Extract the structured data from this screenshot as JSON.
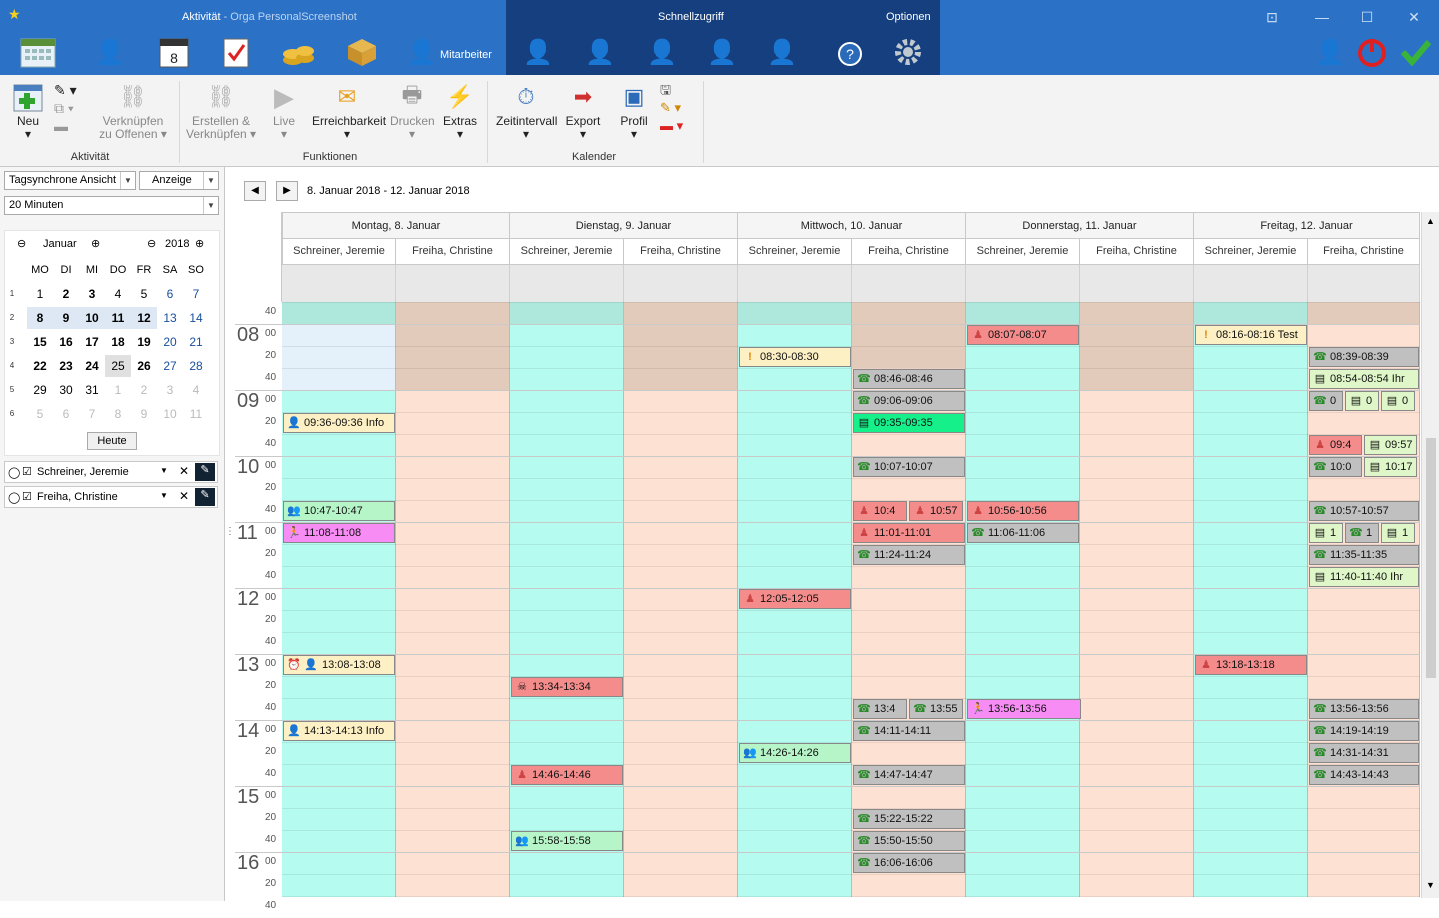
{
  "app": {
    "title_section": "Aktivität",
    "title_app": " - Orga PersonalScreenshot",
    "quick_access": "Schnellzugriff",
    "options": "Optionen",
    "mitarbeiter": "Mitarbeiter"
  },
  "ribbon": {
    "neu": "Neu",
    "verknuepfen": "Verknüpfen",
    "zu_offenen": "zu Offenen",
    "erstellen": "Erstellen &",
    "verknuepfen2": "Verknüpfen",
    "live": "Live",
    "erreichbarkeit": "Erreichbarkeit",
    "drucken": "Drucken",
    "extras": "Extras",
    "zeitintervall": "Zeitintervall",
    "export": "Export",
    "profil": "Profil",
    "grp_aktivitaet": "Aktivität",
    "grp_funktionen": "Funktionen",
    "grp_kalender": "Kalender"
  },
  "left": {
    "view_select": "Tagsynchrone Ansicht",
    "anzeige": "Anzeige",
    "interval_select": "20 Minuten",
    "month": "Januar",
    "year": "2018",
    "weekdays": [
      "MO",
      "DI",
      "MI",
      "DO",
      "FR",
      "SA",
      "SO"
    ],
    "weeks": [
      "1",
      "2",
      "3",
      "4",
      "5",
      "6"
    ],
    "days": [
      [
        "1",
        "2",
        "3",
        "4",
        "5",
        "6",
        "7"
      ],
      [
        "8",
        "9",
        "10",
        "11",
        "12",
        "13",
        "14"
      ],
      [
        "15",
        "16",
        "17",
        "18",
        "19",
        "20",
        "21"
      ],
      [
        "22",
        "23",
        "24",
        "25",
        "26",
        "27",
        "28"
      ],
      [
        "29",
        "30",
        "31",
        "1",
        "2",
        "3",
        "4"
      ],
      [
        "5",
        "6",
        "7",
        "8",
        "9",
        "10",
        "11"
      ]
    ],
    "today_button": "Heute",
    "resources": [
      "Schreiner, Jeremie",
      "Freiha, Christine"
    ]
  },
  "calendar": {
    "range": "8. Januar 2018 - 12. Januar 2018",
    "days": [
      "Montag, 8. Januar",
      "Dienstag, 9. Januar",
      "Mittwoch, 10. Januar",
      "Donnerstag, 11. Januar",
      "Freitag, 12. Januar"
    ],
    "persons": [
      "Schreiner, Jeremie",
      "Freiha, Christine"
    ],
    "hours": [
      "08",
      "09",
      "10",
      "11",
      "12",
      "13",
      "14",
      "15",
      "16"
    ],
    "minute_labels": [
      "40",
      "00",
      "20",
      "40",
      "00",
      "20",
      "40",
      "00",
      "20",
      "40",
      "00",
      "20",
      "40",
      "00",
      "20",
      "40",
      "00",
      "20",
      "40",
      "00",
      "20",
      "40",
      "00",
      "20",
      "40",
      "00",
      "20",
      "40"
    ],
    "events": [
      {
        "col": 6,
        "row": 1,
        "text": "08:07-08:07",
        "color": "red",
        "icon": "person-icon"
      },
      {
        "col": 8,
        "row": 1,
        "text": "08:16-08:16 Test",
        "color": "lyel",
        "icon": "alert-icon"
      },
      {
        "col": 4,
        "row": 2,
        "text": "08:30-08:30",
        "color": "lyel",
        "icon": "alert-icon"
      },
      {
        "col": 9,
        "row": 2,
        "text": "08:39-08:39",
        "color": "gray",
        "icon": "phone-icon"
      },
      {
        "col": 5,
        "row": 3,
        "text": "08:46-08:46",
        "color": "gray",
        "icon": "phone-icon"
      },
      {
        "col": 9,
        "row": 3,
        "text": "08:54-08:54 Ihr",
        "color": "lg",
        "icon": "note-icon"
      },
      {
        "col": 5,
        "row": 4,
        "text": "09:06-09:06",
        "color": "gray",
        "icon": "phone-icon"
      },
      {
        "col": 9,
        "row": 4,
        "text": "0",
        "color": "gray",
        "icon": "phone-icon",
        "part": 0
      },
      {
        "col": 9,
        "row": 4,
        "text": "0",
        "color": "lg",
        "icon": "note-icon",
        "part": 1
      },
      {
        "col": 9,
        "row": 4,
        "text": "0",
        "color": "lg",
        "icon": "note-icon",
        "part": 2
      },
      {
        "col": 0,
        "row": 5,
        "text": "09:36-09:36 Info",
        "color": "lyel",
        "icon": "user-icon"
      },
      {
        "col": 5,
        "row": 5,
        "text": "09:35-09:35",
        "color": "bgreen",
        "icon": "note-icon"
      },
      {
        "col": 9,
        "row": 6,
        "text": "09:4",
        "color": "red",
        "icon": "person-icon",
        "part": 0,
        "parts": 2
      },
      {
        "col": 9,
        "row": 6,
        "text": "09:57",
        "color": "lg",
        "icon": "note-icon",
        "part": 1,
        "parts": 2
      },
      {
        "col": 5,
        "row": 7,
        "text": "10:07-10:07",
        "color": "gray",
        "icon": "phone-icon"
      },
      {
        "col": 9,
        "row": 7,
        "text": "10:0",
        "color": "gray",
        "icon": "phone-icon",
        "part": 0,
        "parts": 2
      },
      {
        "col": 9,
        "row": 7,
        "text": "10:17",
        "color": "lg",
        "icon": "note-icon",
        "part": 1,
        "parts": 2
      },
      {
        "col": 0,
        "row": 9,
        "text": "10:47-10:47",
        "color": "green",
        "icon": "group-icon"
      },
      {
        "col": 5,
        "row": 9,
        "text": "10:4",
        "color": "red",
        "icon": "person-icon",
        "part": 0,
        "parts": 2
      },
      {
        "col": 5,
        "row": 9,
        "text": "10:57",
        "color": "red",
        "icon": "person-icon",
        "part": 1,
        "parts": 2
      },
      {
        "col": 6,
        "row": 9,
        "text": "10:56-10:56",
        "color": "red",
        "icon": "person-icon"
      },
      {
        "col": 9,
        "row": 9,
        "text": "10:57-10:57",
        "color": "gray",
        "icon": "phone-icon"
      },
      {
        "col": 0,
        "row": 10,
        "text": "11:08-11:08",
        "color": "mag",
        "icon": "runner-icon"
      },
      {
        "col": 5,
        "row": 10,
        "text": "11:01-11:01",
        "color": "red",
        "icon": "person-icon"
      },
      {
        "col": 6,
        "row": 10,
        "text": "11:06-11:06",
        "color": "gray",
        "icon": "phone-icon"
      },
      {
        "col": 9,
        "row": 10,
        "text": "1",
        "color": "lg",
        "icon": "note-icon",
        "part": 0
      },
      {
        "col": 9,
        "row": 10,
        "text": "1",
        "color": "gray",
        "icon": "phone-icon",
        "part": 1
      },
      {
        "col": 9,
        "row": 10,
        "text": "1",
        "color": "lg",
        "icon": "note-icon",
        "part": 2
      },
      {
        "col": 5,
        "row": 11,
        "text": "11:24-11:24",
        "color": "gray",
        "icon": "phone-icon"
      },
      {
        "col": 9,
        "row": 11,
        "text": "11:35-11:35",
        "color": "gray",
        "icon": "phone-icon"
      },
      {
        "col": 9,
        "row": 12,
        "text": "11:40-11:40 Ihr",
        "color": "lg",
        "icon": "note-icon"
      },
      {
        "col": 4,
        "row": 13,
        "text": "12:05-12:05",
        "color": "red",
        "icon": "person-icon"
      },
      {
        "col": 0,
        "row": 16,
        "text": "13:08-13:08",
        "color": "lyel",
        "icon": "alarm-icon",
        "pad": true
      },
      {
        "col": 8,
        "row": 16,
        "text": "13:18-13:18",
        "color": "red",
        "icon": "person-icon"
      },
      {
        "col": 2,
        "row": 17,
        "text": "13:34-13:34",
        "color": "red",
        "icon": "skull-icon"
      },
      {
        "col": 5,
        "row": 18,
        "text": "13:4",
        "color": "gray",
        "icon": "phone-icon",
        "part": 0,
        "parts": 2
      },
      {
        "col": 5,
        "row": 18,
        "text": "13:55",
        "color": "gray",
        "icon": "phone-icon",
        "part": 1,
        "parts": 2
      },
      {
        "col": 6,
        "row": 18,
        "text": "13:56-13:56",
        "color": "mag",
        "icon": "runner-icon",
        "wide": true
      },
      {
        "col": 9,
        "row": 18,
        "text": "13:56-13:56",
        "color": "gray",
        "icon": "phone-icon"
      },
      {
        "col": 0,
        "row": 19,
        "text": "14:13-14:13 Info",
        "color": "lyel",
        "icon": "user-icon"
      },
      {
        "col": 5,
        "row": 19,
        "text": "14:11-14:11",
        "color": "gray",
        "icon": "phone-icon"
      },
      {
        "col": 9,
        "row": 19,
        "text": "14:19-14:19",
        "color": "gray",
        "icon": "phone-icon"
      },
      {
        "col": 4,
        "row": 20,
        "text": "14:26-14:26",
        "color": "green",
        "icon": "group-icon"
      },
      {
        "col": 9,
        "row": 20,
        "text": "14:31-14:31",
        "color": "gray",
        "icon": "phone-icon"
      },
      {
        "col": 2,
        "row": 21,
        "text": "14:46-14:46",
        "color": "red",
        "icon": "person-icon"
      },
      {
        "col": 5,
        "row": 21,
        "text": "14:47-14:47",
        "color": "gray",
        "icon": "phone-icon"
      },
      {
        "col": 9,
        "row": 21,
        "text": "14:43-14:43",
        "color": "gray",
        "icon": "phone-icon"
      },
      {
        "col": 5,
        "row": 23,
        "text": "15:22-15:22",
        "color": "gray",
        "icon": "phone-icon"
      },
      {
        "col": 2,
        "row": 24,
        "text": "15:58-15:58",
        "color": "green",
        "icon": "group-icon"
      },
      {
        "col": 5,
        "row": 24,
        "text": "15:50-15:50",
        "color": "gray",
        "icon": "phone-icon"
      },
      {
        "col": 5,
        "row": 25,
        "text": "16:06-16:06",
        "color": "gray",
        "icon": "phone-icon"
      }
    ]
  }
}
